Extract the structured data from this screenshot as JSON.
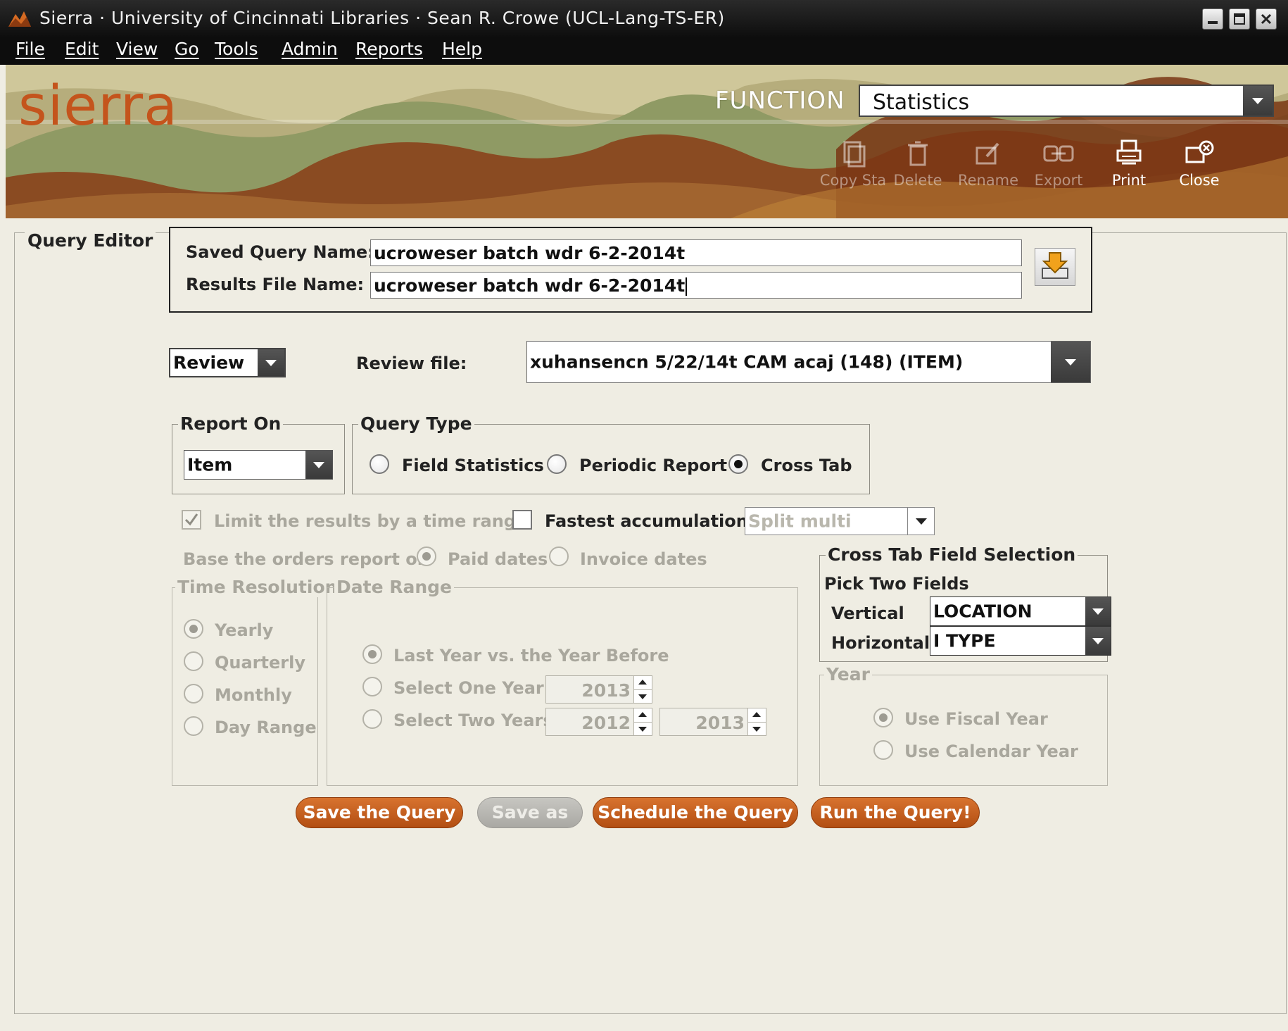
{
  "window": {
    "title": "Sierra · University of Cincinnati Libraries · Sean R. Crowe (UCL-Lang-TS-ER)"
  },
  "menu": [
    "File",
    "Edit",
    "View",
    "Go",
    "Tools",
    "Admin",
    "Reports",
    "Help"
  ],
  "banner": {
    "logo": "sierra",
    "function_label": "FUNCTION",
    "function_value": "Statistics"
  },
  "toolbar": [
    {
      "label": "Copy Sta",
      "icon": "copy-icon",
      "enabled": false
    },
    {
      "label": "Delete",
      "icon": "trash-icon",
      "enabled": false
    },
    {
      "label": "Rename",
      "icon": "rename-icon",
      "enabled": false
    },
    {
      "label": "Export",
      "icon": "export-icon",
      "enabled": false
    },
    {
      "label": "Print",
      "icon": "printer-icon",
      "enabled": true
    },
    {
      "label": "Close",
      "icon": "close-icon",
      "enabled": true
    }
  ],
  "editor": {
    "title": "Query Editor",
    "saved_query_label": "Saved Query Name:",
    "saved_query_value": "ucroweser batch wdr 6-2-2014t",
    "results_file_label": "Results File Name:",
    "results_file_value": "ucroweser batch wdr 6-2-2014t",
    "review_select": "Review",
    "review_file_label": "Review file:",
    "review_file_value": "xuhansencn 5/22/14t CAM acaj (148) (ITEM)",
    "report_on": {
      "legend": "Report On",
      "value": "Item"
    },
    "query_type": {
      "legend": "Query Type",
      "options": [
        "Field Statistics",
        "Periodic Report",
        "Cross Tab"
      ],
      "selected": "Cross Tab"
    },
    "limit_time_range_label": "Limit the results by a time range",
    "fastest_accumulation_label": "Fastest accumulation",
    "split_multi_value": "Split multi",
    "base_orders_label": "Base the orders report on",
    "paid_dates_label": "Paid dates",
    "invoice_dates_label": "Invoice dates",
    "time_resolution": {
      "legend": "Time Resolution",
      "options": [
        "Yearly",
        "Quarterly",
        "Monthly",
        "Day Range"
      ],
      "selected": "Yearly"
    },
    "date_range": {
      "legend": "Date Range",
      "options": [
        "Last Year vs. the Year Before",
        "Select One Year",
        "Select Two Years"
      ],
      "selected": "Last Year vs. the Year Before",
      "one_year": "2013",
      "two_years_from": "2012",
      "two_years_to": "2013"
    },
    "cross_tab": {
      "legend": "Cross Tab Field Selection",
      "pick_label": "Pick Two Fields",
      "vertical_label": "Vertical",
      "vertical_value": "LOCATION",
      "horizontal_label": "Horizontal",
      "horizontal_value": "I TYPE"
    },
    "year": {
      "legend": "Year",
      "options": [
        "Use Fiscal Year",
        "Use Calendar Year"
      ],
      "selected": "Use Fiscal Year"
    },
    "buttons": {
      "save": "Save the Query",
      "save_as": "Save as",
      "schedule": "Schedule the Query",
      "run": "Run the Query!"
    }
  }
}
